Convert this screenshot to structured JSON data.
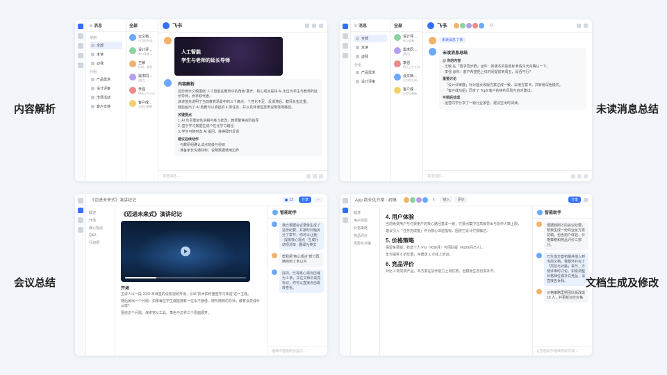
{
  "captions": {
    "tl": "内容解析",
    "tr": "未读消息总结",
    "bl": "会议总结",
    "br": "文档生成及修改"
  },
  "assistant_name": "飞书",
  "sidebar": {
    "header": "消息",
    "groups": [
      {
        "label": "常用",
        "items": [
          "全部",
          "未读",
          "@我"
        ]
      },
      {
        "label": "分组",
        "items": [
          "产品需求",
          "设计评审",
          "市场活动",
          "客户支持"
        ]
      }
    ]
  },
  "chatlist": {
    "header": "全部",
    "items": [
      {
        "name": "云文档助手",
        "sub": "已为你生成摘要",
        "av": "av-b"
      },
      {
        "name": "设计评审群",
        "sub": "有12条新消息",
        "av": "av-g"
      },
      {
        "name": "王敏",
        "sub": "好的，收到",
        "av": "av-o"
      },
      {
        "name": "需求同步群",
        "sub": "[图片]",
        "av": "av-p"
      },
      {
        "name": "李强",
        "sub": "明天上午十点",
        "av": "av-r"
      },
      {
        "name": "客户成功组",
        "sub": "方案已更新",
        "av": "av-y"
      }
    ]
  },
  "tl": {
    "hero_line1": "人工智能",
    "hero_line2": "学生与老师的延长导师",
    "analysis": {
      "title": "内容解析",
      "lines": [
        "这份演示文稿围绕“人工智能在教育中的角色”展开，核心观点是将 AI 定位为学生与教师的延长导师，而非取代者。",
        "演讲首先说明了当前教育场景中的三个痛点：个性化不足、反馈滞后、教师负担过重。",
        "随后给出了 AI 助教可以承担的 4 类任务，并以具体课堂案例说明落地路径。"
      ],
      "sec1": "关键要点",
      "bullets1": [
        "1. AI 负责重复性讲解与练习批改，教师聚焦高阶指导",
        "2. 基于学习数据生成个性化学习路径",
        "3. 学生可随时向 AI 提问，获得即时反馈"
      ],
      "sec2": "建议后续动作",
      "bullets2": [
        "· 与教研组确认试点班级与科目",
        "· 准备家长沟通材料，说明数据使用边界"
      ]
    }
  },
  "tr": {
    "chip": "未读消息 7 条",
    "summary_title": "未读消息总结",
    "sec1": "@ 你的内容",
    "at_items": [
      "· 王敏 在「需求同步群」@你：新版本的验收标准请今天内确认一下。",
      "· 李强 @你：客户希望把上线时间提前到周五，是否可行？"
    ],
    "sec2": "重要讨论",
    "disc_items": [
      "· 「设计评审群」针对首页改版方案达成一致，采用方案 B，并新增深色模式。",
      "· 「客户成功组」同步了 Top5 客户的续约风险与应对建议。"
    ],
    "sec3": "可稍后处理",
    "later_items": [
      "· 运营同学分享了一篇行业报告，建议空闲时阅读。"
    ],
    "members_count": "12"
  },
  "bl": {
    "doc_title": "《迈进未来式》演讲纪记",
    "outline": [
      "概述",
      "开场",
      "核心观点",
      "Q&A",
      "行动项"
    ],
    "section": "开场",
    "paragraphs": [
      "主讲人以一段 2030 年课堂的设想视频开场，引出“技术如何重塑学习体验”这一主题。",
      "随后抛出一个问题：如果每位学生都能拥有一位永不疲倦、随叫随到的导师，教育会变成什么样？",
      "围绕这个问题，演讲将从工具、角色与边界三个层面展开。"
    ],
    "assist": {
      "title": "智能助手",
      "msgs": [
        {
          "role": "ai",
          "text": "我已根据会议录像生成了这份纪要，并按时间轴拆分了章节。你可以让我：\n· 提炼核心观点\n· 生成行动项清单\n· 翻译为英文"
        },
        {
          "role": "user",
          "text": "帮我把“核心观点”部分再精简到 3 条以内"
        },
        {
          "role": "ai",
          "text": "好的，已将核心观点压缩为 3 条，并在文档中高亮标记，你可以直接点击跳转查看。"
        }
      ],
      "input_placeholder": "继续向智能助手提问…"
    },
    "toolbar": {
      "share": "分享",
      "more": "···"
    }
  },
  "br": {
    "doc_title": "App 商业化方案 · 初稿",
    "outline": [
      "概述",
      "用户体验",
      "价格策略",
      "竞品评价",
      "风险与对策"
    ],
    "h_intro": "4. 用户体验",
    "p_intro": [
      "当前免费用户与付费用户的核心路径基本一致，付费点集中在高级导出与协作人数上限。",
      "建议引入「任务完成度」作为核心体验指标，围绕它设计付费触达。"
    ],
    "h_price": "5. 价格策略",
    "p_price": [
      "保留免费版，新增个人 Pro（¥39/月）与团队版（¥199/月/5人）。",
      "年付提供 8 折优惠，并赠送 1 次线上培训。"
    ],
    "h_comp": "6. 竞品评价",
    "p_comp": [
      "对比 3 款同类产品，本方案在协作能力上有优势，但模板生态仍需补齐。"
    ],
    "assist": {
      "title": "智能助手",
      "msgs": [
        {
          "role": "user",
          "text": "根据我刚才的会议纪要，帮我生成一份商业化方案初稿，包含用户体验、价格策略和竞品评价三部分。"
        },
        {
          "role": "ai",
          "text": "已生成方案初稿并插入到当前文档。我额外补充了「风险与对策」章节，方便评审时讨论。如需调整价格档位或补充竞品，请直接告诉我。"
        },
        {
          "role": "user",
          "text": "价格策略里把团队版改成 10 人，并更新对应价格"
        }
      ],
      "input_placeholder": "让智能助手继续修改文档…"
    },
    "toolbar": {
      "share": "分享",
      "insert": "插入",
      "comment": "评论"
    },
    "members_count": "6"
  },
  "footer_placeholder": "发送消息…"
}
